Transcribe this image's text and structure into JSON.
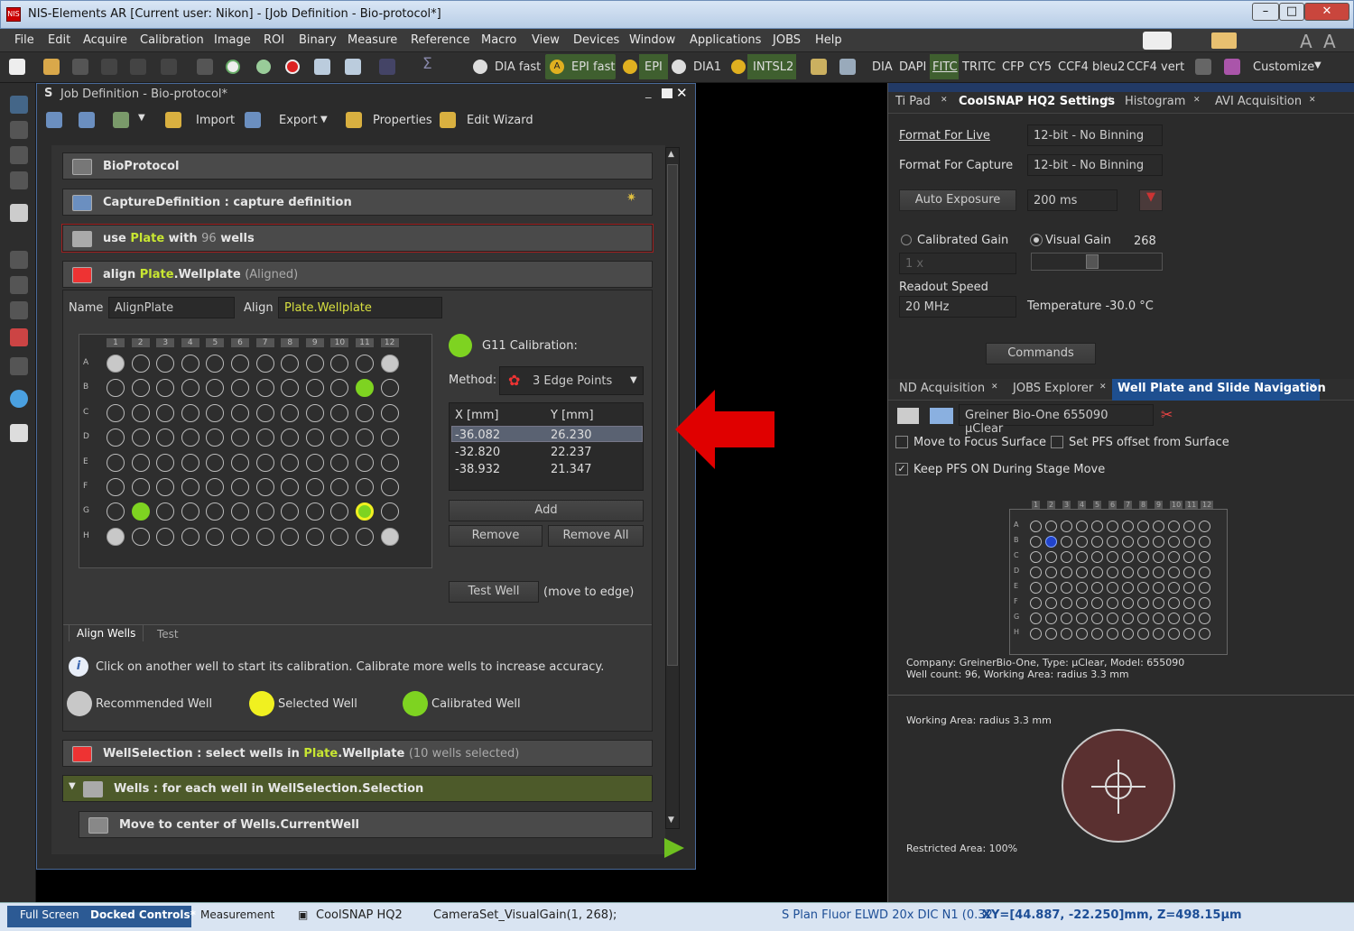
{
  "window": {
    "title": "NIS-Elements AR [Current user: Nikon] - [Job Definition - Bio-protocol*]",
    "app_icon": "NIS"
  },
  "menu": [
    "File",
    "Edit",
    "Acquire",
    "Calibration",
    "Image",
    "ROI",
    "Binary",
    "Measure",
    "Reference",
    "Macro",
    "View",
    "Devices",
    "Window",
    "Applications",
    "JOBS",
    "Help"
  ],
  "toolbar": {
    "dia_fast": "DIA fast",
    "epi_fast": "EPI fast",
    "epi": "EPI",
    "dia1": "DIA1",
    "intsl2": "INTSL2",
    "dia": "DIA",
    "dapi": "DAPI",
    "fitc": "FITC",
    "tritc": "TRITC",
    "cfp": "CFP",
    "cy5": "CY5",
    "ccf4_bleu2": "CCF4 bleu2",
    "ccf4_vert": "CCF4 vert",
    "customize": "Customize",
    "epi_badge": "A"
  },
  "job": {
    "title": "Job Definition - Bio-protocol*",
    "import": "Import",
    "export": "Export",
    "properties": "Properties",
    "edit_wizard": "Edit Wizard",
    "rows": {
      "bioprotocol": "BioProtocol",
      "capture_a": "CaptureDefinition",
      "capture_b": ": capture  definition",
      "plate_a": "use ",
      "plate_hl": "Plate",
      "plate_b": " with ",
      "plate_n": "96",
      "plate_c": "  wells",
      "align_a": "align ",
      "align_hl": "Plate",
      "align_b": ".Wellplate",
      "align_c": "(Aligned)",
      "wellsel_a": "WellSelection  :  select  wells  in ",
      "wellsel_hl": "Plate",
      "wellsel_b": ".Wellplate",
      "wellsel_c": "(10  wells  selected)",
      "wells": "Wells  :  for  each  well  in  WellSelection.Selection",
      "move": "Move  to  center  of  Wells.CurrentWell"
    },
    "name_label": "Name",
    "name_value": "AlignPlate",
    "align_label": "Align",
    "align_value": "Plate.Wellplate",
    "cols": [
      "1",
      "2",
      "3",
      "4",
      "5",
      "6",
      "7",
      "8",
      "9",
      "10",
      "11",
      "12"
    ],
    "rows_lbl": [
      "A",
      "B",
      "C",
      "D",
      "E",
      "F",
      "G",
      "H"
    ],
    "calibration": "G11 Calibration:",
    "method_label": "Method:",
    "method_value": "3 Edge Points",
    "table_headers": [
      "X [mm]",
      "Y [mm]"
    ],
    "table_rows": [
      [
        "-36.082",
        "26.230"
      ],
      [
        "-32.820",
        "22.237"
      ],
      [
        "-38.932",
        "21.347"
      ]
    ],
    "add": "Add",
    "remove": "Remove",
    "remove_all": "Remove All",
    "test_well": "Test Well",
    "move_to_edge": "(move to edge)",
    "tab_align": "Align Wells",
    "tab_test": "Test",
    "info": "Click on another well to start its calibration. Calibrate more wells to increase accuracy.",
    "legend_recommended": "Recommended Well",
    "legend_selected": "Selected Well",
    "legend_calibrated": "Calibrated Well"
  },
  "right": {
    "tabs1": [
      "Ti Pad",
      "CoolSNAP HQ2 Settings",
      "Histogram",
      "AVI Acquisition"
    ],
    "format_live_label": "Format For Live",
    "format_live": "12-bit - No Binning",
    "format_capture_label": "Format For Capture",
    "format_capture": "12-bit - No Binning",
    "auto_exposure": "Auto Exposure",
    "exposure": "200 ms",
    "calibrated_gain": "Calibrated Gain",
    "visual_gain": "Visual Gain",
    "gain_value": "268",
    "gain_mult": "1 x",
    "readout_label": "Readout Speed",
    "readout": "20 MHz",
    "temperature": "Temperature -30.0 °C",
    "commands": "Commands",
    "tabs2": [
      "ND Acquisition",
      "JOBS Explorer",
      "Well Plate and Slide Navigation"
    ],
    "plate_select": "Greiner Bio-One 655090 µClear",
    "move_focus": "Move to Focus Surface",
    "set_pfs": "Set PFS offset from Surface",
    "keep_pfs": "Keep PFS ON During Stage Move",
    "company": "Company: GreinerBio-One, Type: µClear, Model: 655090",
    "well_count": "Well count: 96, Working Area: radius 3.3 mm",
    "working_area": "Working Area: radius 3.3 mm",
    "restricted": "Restricted Area: 100%"
  },
  "status": {
    "full_screen": "Full Screen",
    "docked": "Docked Controls*",
    "measurement": "Measurement",
    "camera": "CoolSNAP HQ2",
    "command": "CameraSet_VisualGain(1, 268);",
    "objective": "S Plan Fluor ELWD 20x DIC N1 (0.32",
    "xy": "XY=[44.887, -22.250]mm, Z=498.15µm"
  },
  "colors": {
    "highlight": "#c8e632",
    "calibrated": "#7ed321",
    "selected": "#f0f020",
    "recommended": "#c8c8c8",
    "arrow": "#e00000"
  }
}
